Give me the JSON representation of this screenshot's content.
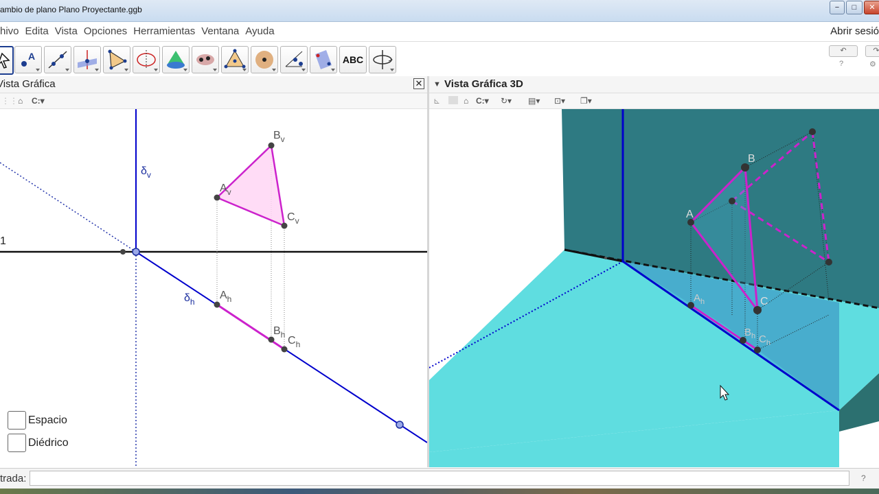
{
  "window": {
    "title": "ambio de plano Plano Proyectante.ggb",
    "minimize": "−",
    "maximize": "□",
    "close": "✕"
  },
  "menubar": {
    "items": [
      "hivo",
      "Edita",
      "Vista",
      "Opciones",
      "Herramientas",
      "Ventana",
      "Ayuda"
    ],
    "session": "Abrir sesió"
  },
  "toolbar": {
    "text_tool_label": "ABC",
    "undo": "↶",
    "redo": "↷",
    "help": "?",
    "settings": "⚙"
  },
  "view2d": {
    "title": "Vista Gráfica",
    "close": "✕",
    "labels": {
      "Bv": "B",
      "Bv_sub": "v",
      "Av": "A",
      "Av_sub": "v",
      "Cv": "C",
      "Cv_sub": "v",
      "Ah": "A",
      "Ah_sub": "h",
      "Bh": "B",
      "Bh_sub": "h",
      "Ch": "C",
      "Ch_sub": "h",
      "dv": "δ",
      "dv_sub": "v",
      "dh": "δ",
      "dh_sub": "h",
      "lt": "1"
    },
    "checkboxes": [
      {
        "label": "Espacio",
        "checked": false
      },
      {
        "label": "Diédrico",
        "checked": false
      }
    ]
  },
  "view3d": {
    "title": "Vista Gráfica 3D",
    "labels": {
      "A": "A",
      "B": "B",
      "C": "C",
      "Ah": "A",
      "Ah_sub": "h",
      "Bh": "B",
      "Bh_sub": "h",
      "Ch": "C",
      "Ch_sub": "h"
    }
  },
  "inputbar": {
    "label": "trada:",
    "value": "",
    "help": "?"
  },
  "colors": {
    "magenta": "#cc22cc",
    "blue": "#0000cc",
    "teal_wall": "#2e7a82",
    "cyan_floor": "#5fdde0"
  }
}
